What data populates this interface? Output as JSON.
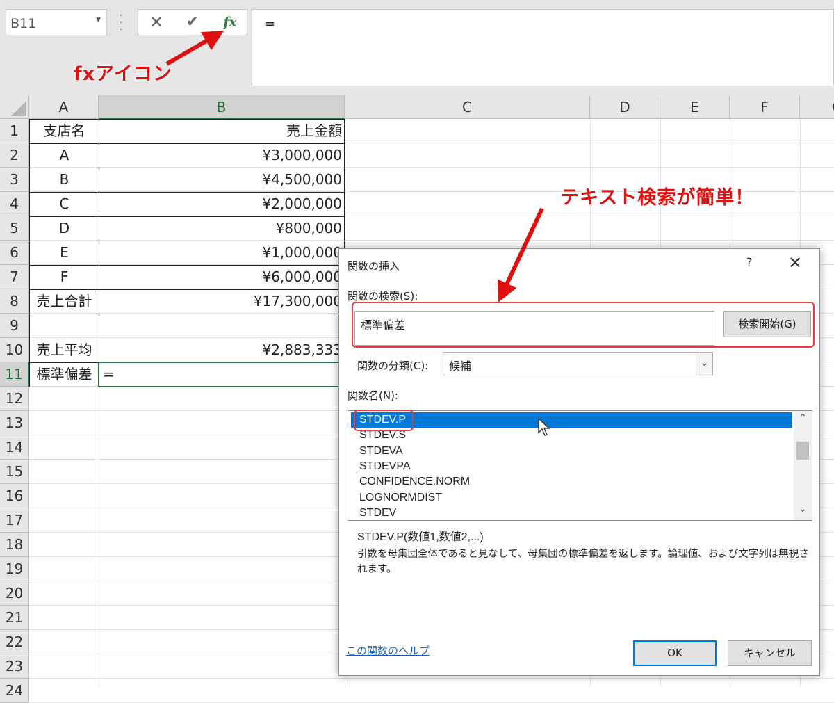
{
  "formula_bar": {
    "name_box": "B11",
    "formula": "=",
    "fx_label": "fx",
    "cancel_icon": "✕",
    "enter_icon": "✔"
  },
  "annotations": {
    "fx_icon": "fxアイコン",
    "text_search": "テキスト検索が簡単！",
    "color": "#e01010"
  },
  "sheet": {
    "columns": [
      "A",
      "B",
      "C",
      "D",
      "E",
      "F",
      "G"
    ],
    "rows": [
      "1",
      "2",
      "3",
      "4",
      "5",
      "6",
      "7",
      "8",
      "9",
      "10",
      "11",
      "12",
      "13",
      "14",
      "15",
      "16",
      "17",
      "18",
      "19",
      "20",
      "21",
      "22",
      "23",
      "24"
    ],
    "cells": [
      {
        "ref": "A1",
        "value": "支店名"
      },
      {
        "ref": "B1",
        "value": "売上金額"
      },
      {
        "ref": "A2",
        "value": "A"
      },
      {
        "ref": "B2",
        "value": "¥3,000,000"
      },
      {
        "ref": "A3",
        "value": "B"
      },
      {
        "ref": "B3",
        "value": "¥4,500,000"
      },
      {
        "ref": "A4",
        "value": "C"
      },
      {
        "ref": "B4",
        "value": "¥2,000,000"
      },
      {
        "ref": "A5",
        "value": "D"
      },
      {
        "ref": "B5",
        "value": "¥800,000"
      },
      {
        "ref": "A6",
        "value": "E"
      },
      {
        "ref": "B6",
        "value": "¥1,000,000"
      },
      {
        "ref": "A7",
        "value": "F"
      },
      {
        "ref": "B7",
        "value": "¥6,000,000"
      },
      {
        "ref": "A8",
        "value": "売上合計"
      },
      {
        "ref": "B8",
        "value": "¥17,300,000"
      },
      {
        "ref": "A10",
        "value": "売上平均"
      },
      {
        "ref": "B10",
        "value": "¥2,883,333"
      },
      {
        "ref": "A11",
        "value": "標準偏差"
      },
      {
        "ref": "B11",
        "value": "="
      }
    ],
    "active_cell": "B11",
    "accent_color": "#217346"
  },
  "dialog": {
    "title": "関数の挿入",
    "help_button": "?",
    "close_button": "✕",
    "search_label": "関数の検索(S):",
    "search_value": "標準偏差",
    "search_button": "検索開始(G)",
    "category_label": "関数の分類(C):",
    "category_value": "候補",
    "function_list_label": "関数名(N):",
    "functions": [
      "STDEV.P",
      "STDEV.S",
      "STDEVA",
      "STDEVPA",
      "CONFIDENCE.NORM",
      "LOGNORMDIST",
      "STDEV"
    ],
    "selected_function": "STDEV.P",
    "signature": "STDEV.P(数値1,数値2,...)",
    "description": "引数を母集団全体であると見なして、母集団の標準偏差を返します。論理値、および文字列は無視されます。",
    "help_link": "この関数のヘルプ",
    "ok_button": "OK",
    "cancel_button": "キャンセル",
    "selection_color": "#0078d7"
  }
}
